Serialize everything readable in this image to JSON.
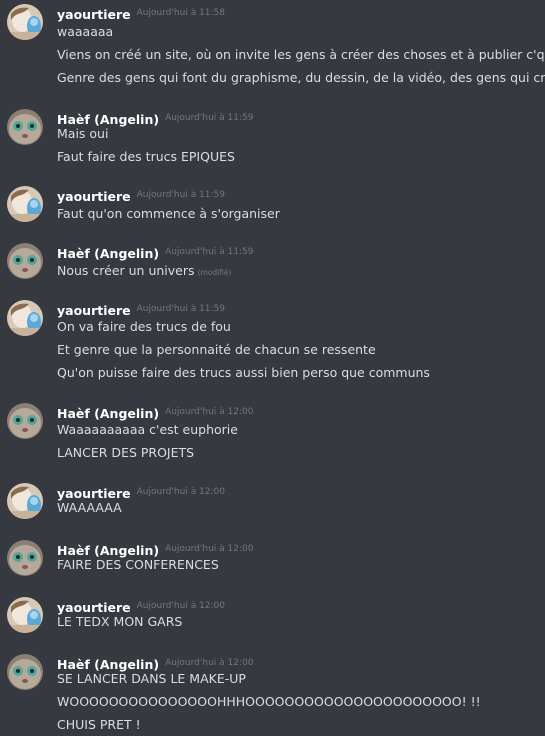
{
  "users": {
    "yaourtiere": {
      "name": "yaourtiere",
      "avatar_icon": "avatar-yaourtiere-icon"
    },
    "haef": {
      "name": "Haèf (Angelin)",
      "avatar_icon": "avatar-haef-icon"
    }
  },
  "edited_label": "(modifié)",
  "messages": [
    {
      "author": "yaourtiere",
      "time": "Aujourd'hui à 11:58",
      "lines": [
        "waaaaaa",
        "Viens on créé un site, où on invite les gens à créer des choses et à publier c'qu'y font",
        "Genre des gens qui font du graphisme, du dessin, de la vidéo, des gens qui créent !"
      ]
    },
    {
      "author": "Haèf (Angelin)",
      "time": "Aujourd'hui à 11:59",
      "lines": [
        "Mais oui",
        "Faut faire des trucs EPIQUES"
      ]
    },
    {
      "author": "yaourtiere",
      "time": "Aujourd'hui à 11:59",
      "lines": [
        "Faut qu'on commence à s'organiser"
      ]
    },
    {
      "author": "Haèf (Angelin)",
      "time": "Aujourd'hui à 11:59",
      "lines": [
        "Nous créer un univers"
      ]
    },
    {
      "author": "yaourtiere",
      "time": "Aujourd'hui à 11:59",
      "lines": [
        "On va faire des trucs de fou",
        "Et genre que la personnaité de chacun se ressente",
        "Qu'on puisse faire des trucs aussi bien perso que communs"
      ]
    },
    {
      "author": "Haèf (Angelin)",
      "time": "Aujourd'hui à 12:00",
      "lines": [
        "Waaaaaaaaaa c'est euphorie",
        "LANCER DES PROJETS"
      ]
    },
    {
      "author": "yaourtiere",
      "time": "Aujourd'hui à 12:00",
      "lines": [
        "WAAAAAA"
      ]
    },
    {
      "author": "Haèf (Angelin)",
      "time": "Aujourd'hui à 12:00",
      "lines": [
        "FAIRE DES CONFERENCES"
      ]
    },
    {
      "author": "yaourtiere",
      "time": "Aujourd'hui à 12:00",
      "lines": [
        "LE TEDX MON GARS"
      ]
    },
    {
      "author": "Haèf (Angelin)",
      "time": "Aujourd'hui à 12:00",
      "lines": [
        "SE LANCER DANS LE MAKE-UP",
        "WOOOOOOOOOOOOOOOHHHOOOOOOOOOOOOOOOOOOOOOO! !!",
        "CHUIS PRET !"
      ]
    }
  ]
}
